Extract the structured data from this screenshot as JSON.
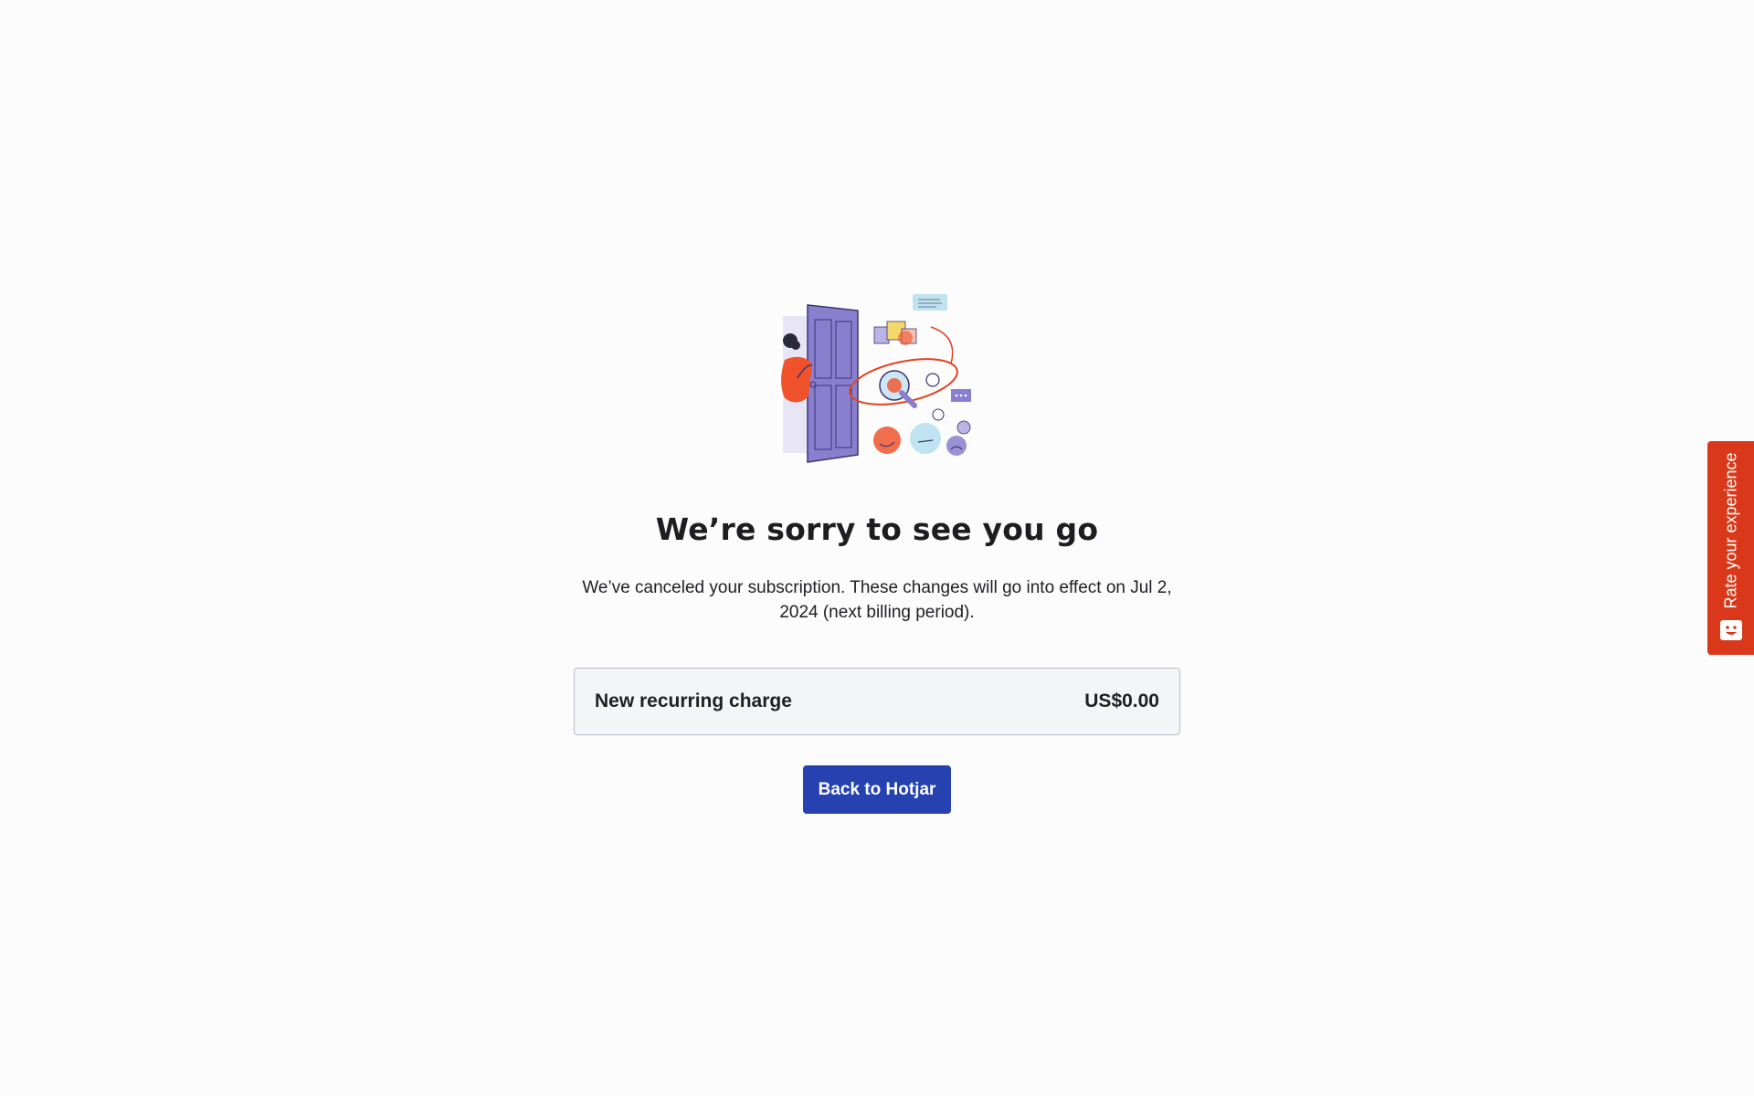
{
  "main": {
    "heading": "We’re sorry to see you go",
    "message": "We’ve canceled your subscription. These changes will go into effect on Jul 2, 2024 (next billing period).",
    "charge": {
      "label": "New recurring charge",
      "value": "US$0.00"
    },
    "back_button_label": "Back to Hotjar"
  },
  "feedback_tab": {
    "label": "Rate your experience",
    "icon": "hotjar-face-icon"
  },
  "illustration": {
    "icon": "goodbye-door-illustration"
  },
  "colors": {
    "background": "#fcfcfc",
    "primary_button": "#2641b0",
    "feedback_tab": "#d9391a",
    "charge_box_bg": "#f4f5f7",
    "charge_box_border": "#b8bcc4",
    "illustration_purple": "#8a7fcf",
    "illustration_red": "#f0532c"
  }
}
